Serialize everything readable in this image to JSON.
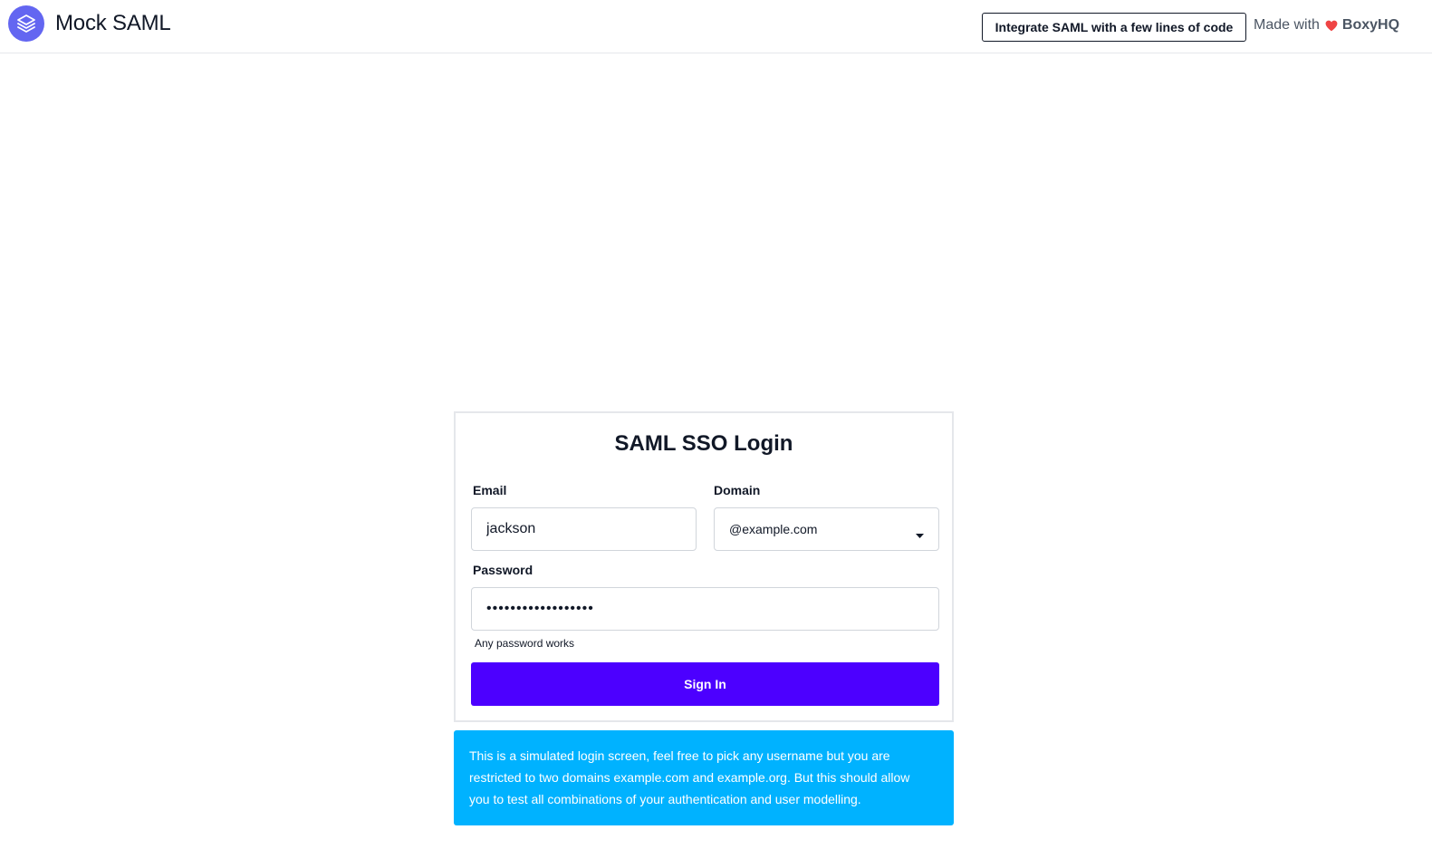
{
  "header": {
    "brand_title": "Mock SAML",
    "integrate_label": "Integrate SAML with a few lines of code",
    "made_with_label": "Made with",
    "boxyhq_label": "BoxyHQ",
    "colors": {
      "logo_bg": "#6366f1",
      "heart": "#ef4444"
    },
    "icons": {
      "logo": "layers-icon",
      "heart": "heart-icon"
    }
  },
  "login": {
    "title": "SAML SSO Login",
    "email": {
      "label": "Email",
      "value": "jackson"
    },
    "domain": {
      "label": "Domain",
      "selected": "@example.com",
      "icon": "caret-down-icon"
    },
    "password": {
      "label": "Password",
      "value": "samlstrongpassword",
      "hint": "Any password works"
    },
    "signin_label": "Sign In",
    "colors": {
      "button": "#4c00ff"
    }
  },
  "info": {
    "text": "This is a simulated login screen, feel free to pick any username but you are restricted to two domains example.com and example.org. But this should allow you to test all combinations of your authentication and user modelling.",
    "colors": {
      "background": "#00b2ff"
    }
  }
}
